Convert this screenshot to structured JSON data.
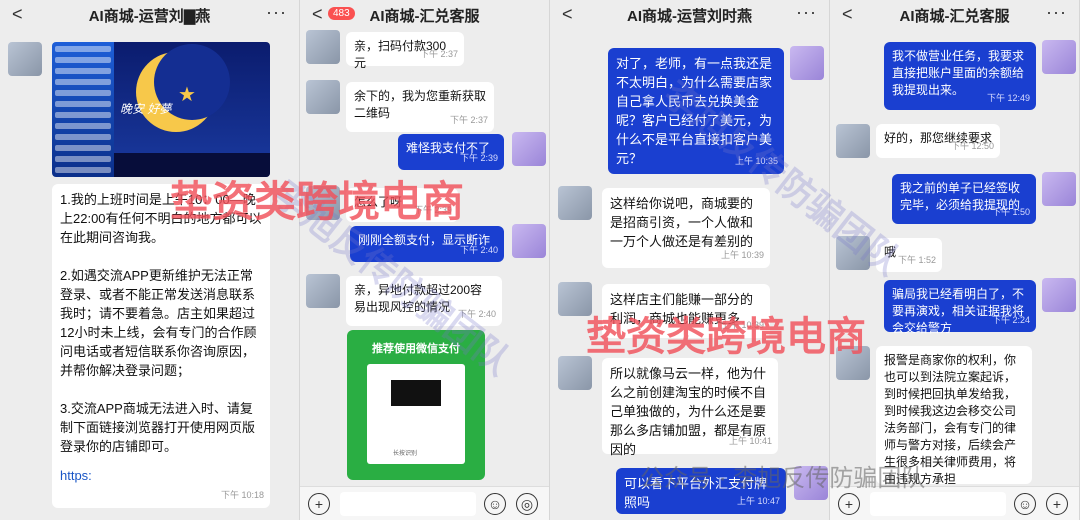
{
  "panels": [
    {
      "title": "AI商城-运营刘▇燕",
      "back": "<",
      "more": "···"
    },
    {
      "title": "AI商城-汇兑客服",
      "back": "<",
      "badge": "483"
    },
    {
      "title": "AI商城-运营刘时燕",
      "back": "<",
      "more": "···"
    },
    {
      "title": "AI商城-汇兑客服",
      "back": "<",
      "more": "···"
    }
  ],
  "p1": {
    "poster_text": "晚安 好夢",
    "msg": "1.我的上班时间是上午10：00—晚上22:00有任何不明白的地方都可以在此期间咨询我。\n\n2.如遇交流APP更新维护无法正常登录、或者不能正常发送消息联系我时；请不要着急。店主如果超过12小时未上线，会有专门的合作顾问电话或者短信联系你咨询原因，并帮你解决登录问题；\n\n3.交流APP商城无法进入时、请复制下面链接浏览器打开使用网页版登录你的店铺即可。",
    "link": "https:",
    "time": "下午 10:18"
  },
  "p2": {
    "msgs": [
      {
        "text": "亲，扫码付款300元",
        "time": "下午 2:37"
      },
      {
        "text": "余下的，我为您重新获取二维码",
        "time": "下午 2:37"
      },
      {
        "text": "难怪我支付不了",
        "time": "下午 2:39"
      },
      {
        "text": "怎么了呀",
        "time": "下午 2:39"
      },
      {
        "text": "刚刚全额支付，显示断诈",
        "time": "下午 2:40"
      },
      {
        "text": "亲，异地付款超过200容易出现风控的情况",
        "time": "下午 2:40"
      }
    ],
    "qr_title": "推荐使用微信支付",
    "qr_small": "长按识别"
  },
  "p3": {
    "msgs": [
      {
        "text": "对了，老师，有一点我还是不太明白，为什么需要店家自己拿人民币去兑换美金呢？客户已经付了美元，为什么不是平台直接扣客户美元？",
        "time": "上午 10:35"
      },
      {
        "text": "这样给你说吧，商城要的是招商引资，一个人做和一万个人做还是有差别的",
        "time": "上午 10:39"
      },
      {
        "text": "这样店主们能赚一部分的利润，商城也能赚更多",
        "time": "上午 10:39"
      },
      {
        "text": "所以就像马云一样，他为什么之前创建淘宝的时候不自己单独做的，为什么还是要那么多店铺加盟，都是有原因的",
        "time": "上午 10:41"
      },
      {
        "text": "可以看下平台外汇支付牌照吗",
        "time": "上午 10:47"
      }
    ]
  },
  "p4": {
    "msgs": [
      {
        "text": "我不做营业任务，我要求直接把账户里面的余额给我提现出来。",
        "time": "下午 12:49"
      },
      {
        "text": "好的，那您继续要求",
        "time": "下午 12:50"
      },
      {
        "text": "我之前的单子已经签收完毕，必须给我提现的",
        "time": "下午 1:50"
      },
      {
        "text": "哦",
        "time": "下午 1:52"
      },
      {
        "text": "骗局我已经看明白了，不要再演戏，相关证据我将会交给警方",
        "time": "下午 2:24"
      },
      {
        "text": "报警是商家你的权利，你也可以到法院立案起诉，到时候把回执单发给我，到时候我这边会移交公司法务部门，会有专门的律师与警方对接，后续会产生很多相关律师费用，将由违规方承担",
        "time": ""
      }
    ]
  },
  "footer": {
    "plus": "+",
    "emoji": "☺",
    "voice": "◎"
  },
  "watermarks": {
    "main1": "垫资类跨境电商",
    "main2": "垫资类跨境电商",
    "faint": "李旭反传防骗团队",
    "account": "公众号 · 李旭反传防骗团队"
  }
}
